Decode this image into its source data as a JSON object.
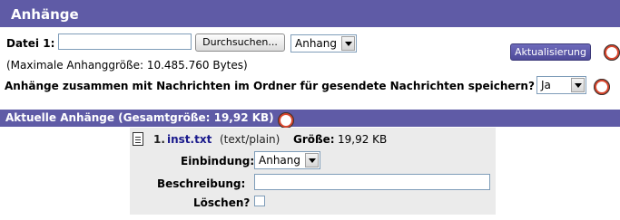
{
  "header": {
    "title": "Anhänge"
  },
  "upload": {
    "file_label": "Datei 1:",
    "file_value": "",
    "browse_label": "Durchsuchen...",
    "disposition_selected": "Anhang",
    "update_label": "Aktualisierung",
    "max_size_text": "(Maximale Anhanggröße: 10.485.760 Bytes)"
  },
  "save_sent": {
    "label": "Anhänge zusammen mit Nachrichten im Ordner für gesendete Nachrichten speichern?",
    "selected": "Ja"
  },
  "current": {
    "title": "Aktuelle Anhänge (Gesamtgröße: 19,92 KB)",
    "items": [
      {
        "number": "1.",
        "filename": "inst.txt",
        "mimetype": "(text/plain)",
        "size_label": "Größe:",
        "size": "19,92 KB",
        "disposition_label": "Einbindung:",
        "disposition_selected": "Anhang",
        "description_label": "Beschreibung:",
        "description_value": "",
        "delete_label": "Löschen?",
        "delete_checked": false
      }
    ]
  },
  "icons": {
    "help": "lifebuoy-help-icon",
    "file": "document-icon"
  },
  "colors": {
    "header_bg": "#5f5ba6",
    "panel_bg": "#ebebeb",
    "link": "#1a1a8c",
    "help_icon": "#d8452c"
  }
}
